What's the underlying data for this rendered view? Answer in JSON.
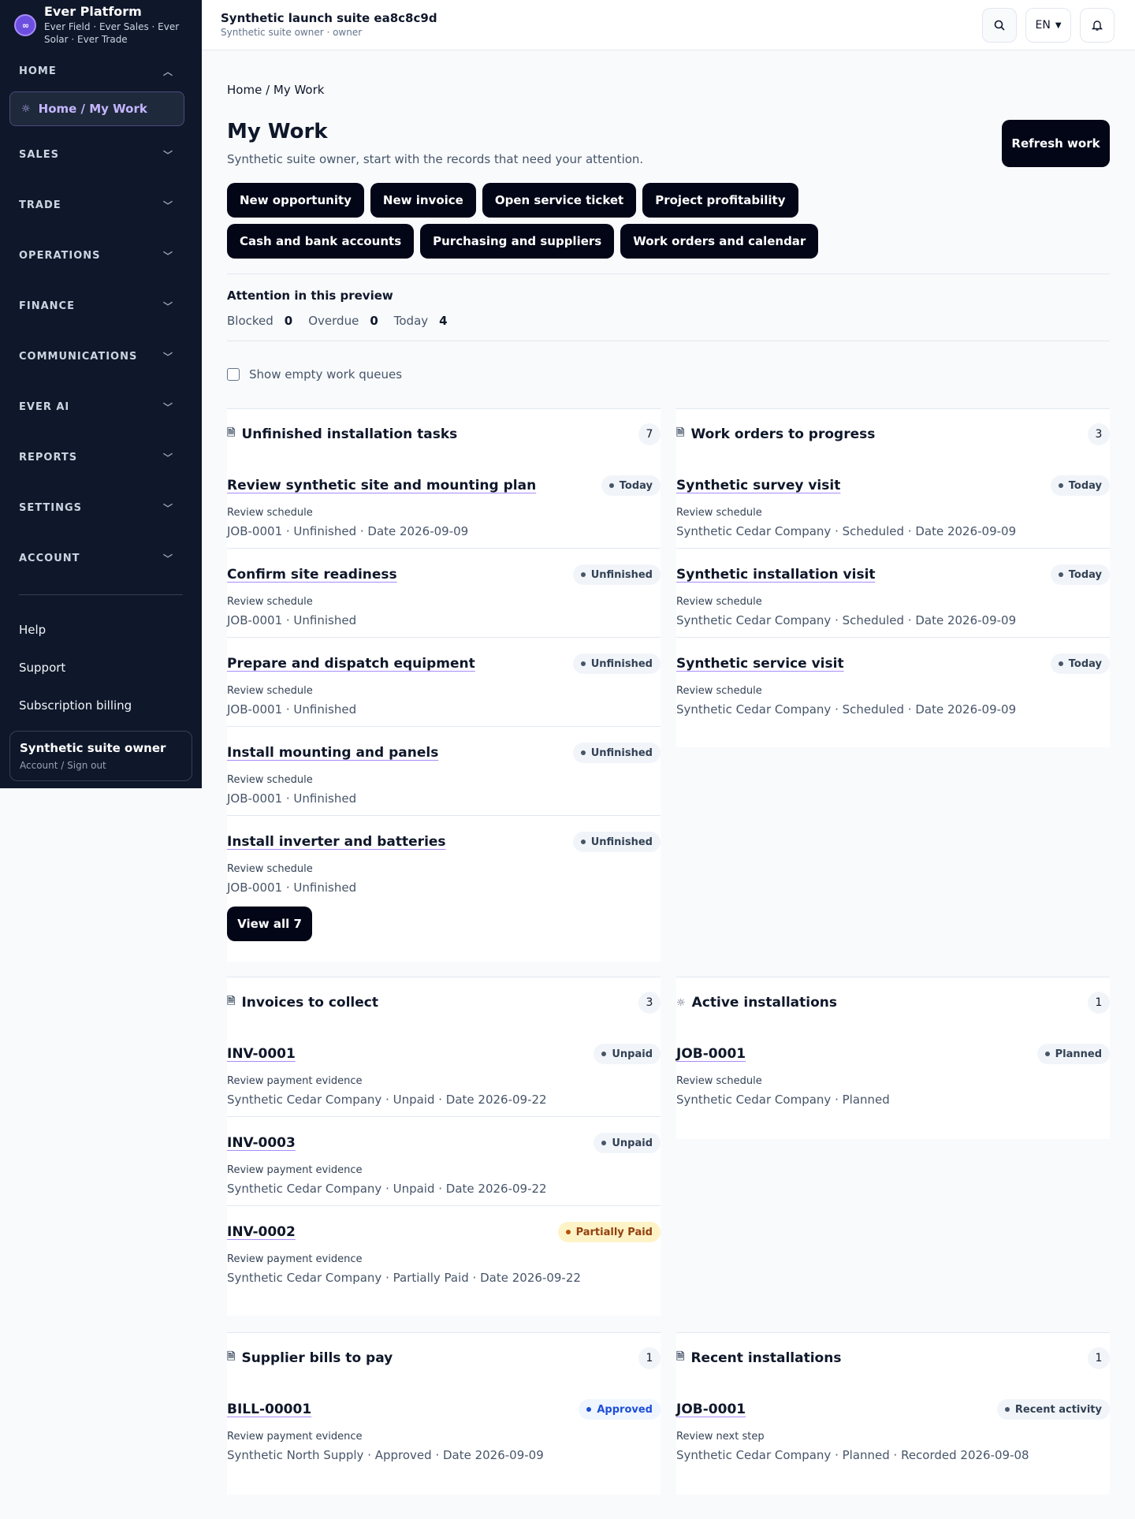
{
  "brand": {
    "title": "Ever Platform",
    "subtitle": "Ever Field · Ever Sales · Ever Solar · Ever Trade",
    "logo_text": "∞"
  },
  "nav": {
    "home_label": "HOME",
    "active_item": "Home / My Work",
    "sections": [
      "SALES",
      "TRADE",
      "OPERATIONS",
      "FINANCE",
      "COMMUNICATIONS",
      "EVER AI",
      "REPORTS",
      "SETTINGS",
      "ACCOUNT"
    ],
    "links": [
      "Help",
      "Support",
      "Subscription billing"
    ],
    "account_name": "Synthetic suite owner",
    "account_sub": "Account / Sign out"
  },
  "topbar": {
    "title": "Synthetic launch suite ea8c8c9d",
    "subtitle": "Synthetic suite owner · owner",
    "language": "EN"
  },
  "page": {
    "breadcrumb": "Home / My Work",
    "title": "My Work",
    "subtitle": "Synthetic suite owner, start with the records that need your attention.",
    "refresh_label": "Refresh work",
    "quick_actions": [
      "New opportunity",
      "New invoice",
      "Open service ticket",
      "Project profitability",
      "Cash and bank accounts",
      "Purchasing and suppliers",
      "Work orders and calendar"
    ],
    "attention_title": "Attention in this preview",
    "attention": [
      {
        "label": "Blocked",
        "value": "0"
      },
      {
        "label": "Overdue",
        "value": "0"
      },
      {
        "label": "Today",
        "value": "4"
      }
    ],
    "show_empty_label": "Show empty work queues"
  },
  "cards": {
    "tasks": {
      "title": "Unfinished installation tasks",
      "count": "7",
      "view_all": "View all 7",
      "items": [
        {
          "name": "Review synthetic site and mounting plan",
          "badge": "Today",
          "action": "Review schedule",
          "meta": "JOB-0001 · Unfinished · Date 2026-09-09"
        },
        {
          "name": "Confirm site readiness",
          "badge": "Unfinished",
          "action": "Review schedule",
          "meta": "JOB-0001 · Unfinished"
        },
        {
          "name": "Prepare and dispatch equipment",
          "badge": "Unfinished",
          "action": "Review schedule",
          "meta": "JOB-0001 · Unfinished"
        },
        {
          "name": "Install mounting and panels",
          "badge": "Unfinished",
          "action": "Review schedule",
          "meta": "JOB-0001 · Unfinished"
        },
        {
          "name": "Install inverter and batteries",
          "badge": "Unfinished",
          "action": "Review schedule",
          "meta": "JOB-0001 · Unfinished"
        }
      ]
    },
    "work_orders": {
      "title": "Work orders to progress",
      "count": "3",
      "items": [
        {
          "name": "Synthetic survey visit",
          "badge": "Today",
          "action": "Review schedule",
          "meta": "Synthetic Cedar Company · Scheduled · Date 2026-09-09"
        },
        {
          "name": "Synthetic installation visit",
          "badge": "Today",
          "action": "Review schedule",
          "meta": "Synthetic Cedar Company · Scheduled · Date 2026-09-09"
        },
        {
          "name": "Synthetic service visit",
          "badge": "Today",
          "action": "Review schedule",
          "meta": "Synthetic Cedar Company · Scheduled · Date 2026-09-09"
        }
      ]
    },
    "invoices": {
      "title": "Invoices to collect",
      "count": "3",
      "items": [
        {
          "name": "INV-0001",
          "badge": "Unpaid",
          "action": "Review payment evidence",
          "meta": "Synthetic Cedar Company · Unpaid · Date 2026-09-22"
        },
        {
          "name": "INV-0003",
          "badge": "Unpaid",
          "action": "Review payment evidence",
          "meta": "Synthetic Cedar Company · Unpaid · Date 2026-09-22"
        },
        {
          "name": "INV-0002",
          "badge": "Partially Paid",
          "action": "Review payment evidence",
          "meta": "Synthetic Cedar Company · Partially Paid · Date 2026-09-22"
        }
      ]
    },
    "installations": {
      "title": "Active installations",
      "count": "1",
      "items": [
        {
          "name": "JOB-0001",
          "badge": "Planned",
          "action": "Review schedule",
          "meta": "Synthetic Cedar Company · Planned"
        }
      ]
    },
    "bills": {
      "title": "Supplier bills to pay",
      "count": "1",
      "items": [
        {
          "name": "BILL-00001",
          "badge": "Approved",
          "action": "Review payment evidence",
          "meta": "Synthetic North Supply · Approved · Date 2026-09-09"
        }
      ]
    },
    "recent": {
      "title": "Recent installations",
      "count": "1",
      "items": [
        {
          "name": "JOB-0001",
          "badge": "Recent activity",
          "action": "Review next step",
          "meta": "Synthetic Cedar Company · Planned · Recorded 2026-09-08"
        }
      ]
    }
  },
  "colors": {
    "sidebar_bg": "#0f172a",
    "accent": "#a78bfa",
    "primary_button": "#020617",
    "warn_badge": "#fef3c7",
    "info_badge": "#eff6ff"
  }
}
